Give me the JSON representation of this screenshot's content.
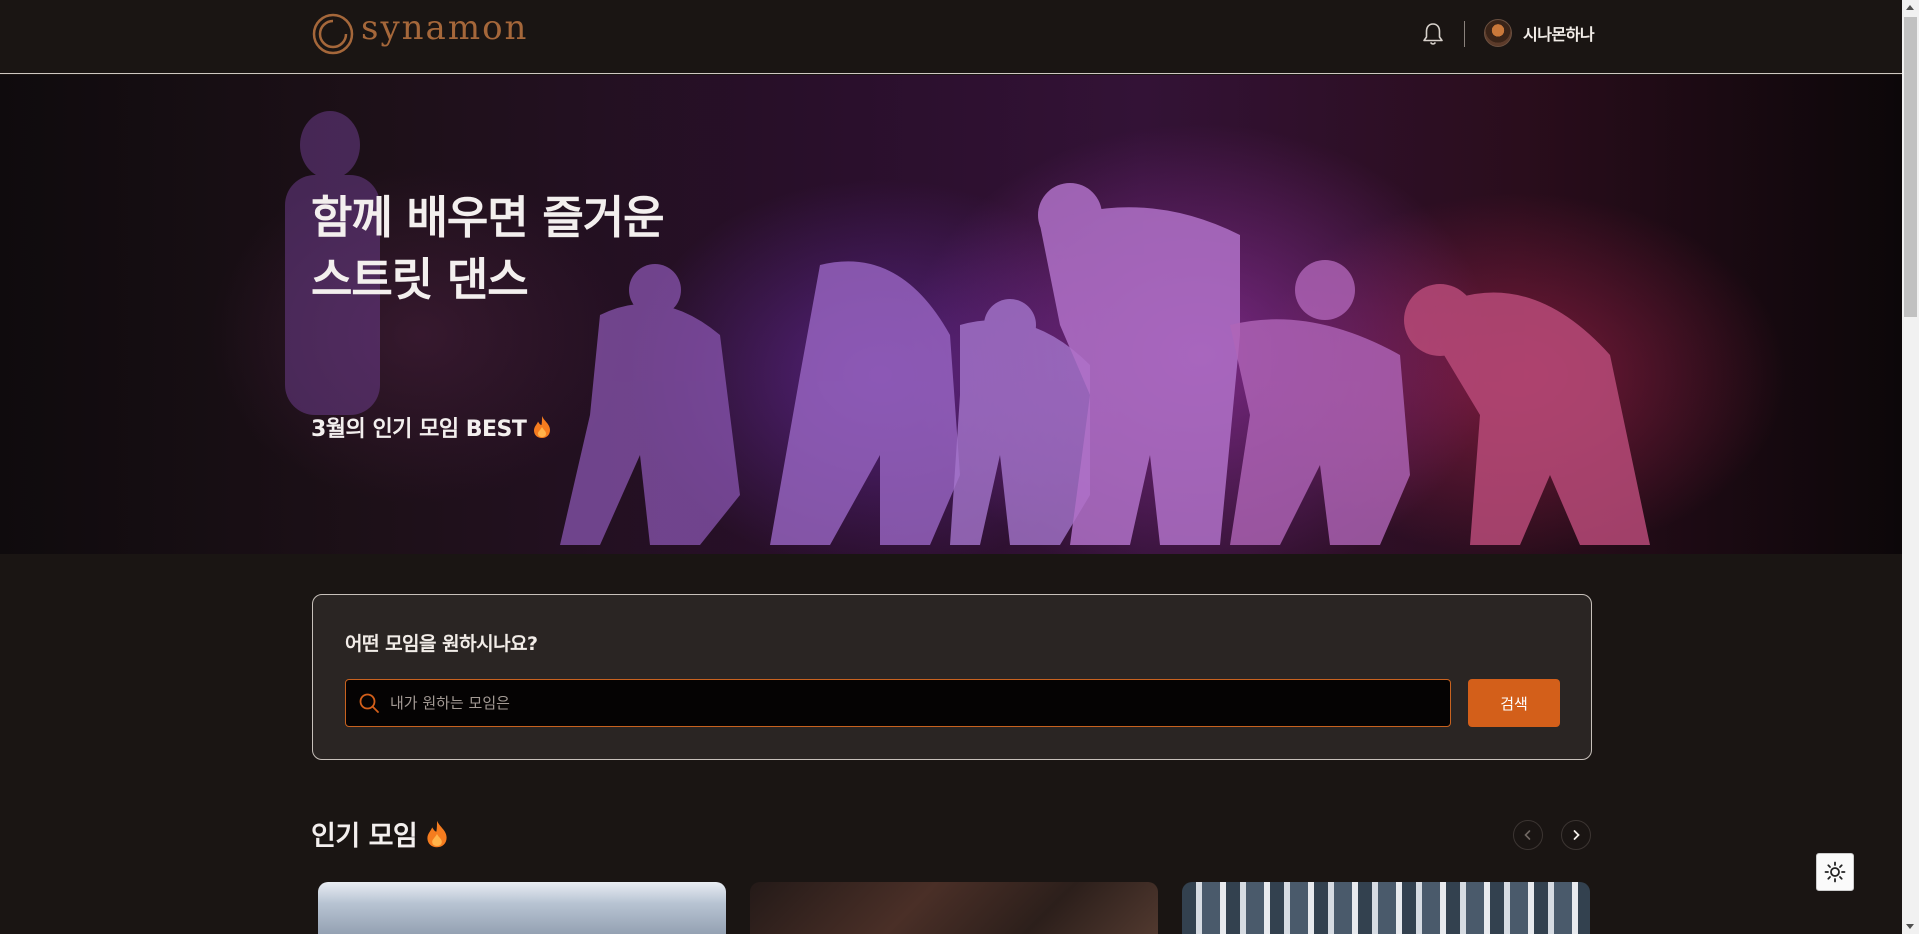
{
  "header": {
    "logo_text": "synamon",
    "bell_icon": "bell-icon",
    "user_name": "시나몬하나",
    "colors": {
      "logo": "#a5673a",
      "background": "#1a1513"
    }
  },
  "hero": {
    "title_line1": "함께 배우면 즐거운",
    "title_line2": "스트릿 댄스",
    "subtitle": "3월의 인기 모임 BEST",
    "subtitle_icon": "fire-icon"
  },
  "search": {
    "heading": "어떤 모임을 원하시나요?",
    "placeholder": "내가 원하는 모임은",
    "value": "",
    "button_label": "검색",
    "colors": {
      "accent": "#d35f1a"
    }
  },
  "popular": {
    "title": "인기 모임",
    "title_icon": "fire-icon",
    "prev_icon": "chevron-left-icon",
    "next_icon": "chevron-right-icon",
    "cards": [
      {
        "image": "sky-photo"
      },
      {
        "image": "wood-interior-photo"
      },
      {
        "image": "gym-shelves-photo"
      }
    ]
  },
  "theme_toggle": {
    "icon": "sun-icon"
  }
}
